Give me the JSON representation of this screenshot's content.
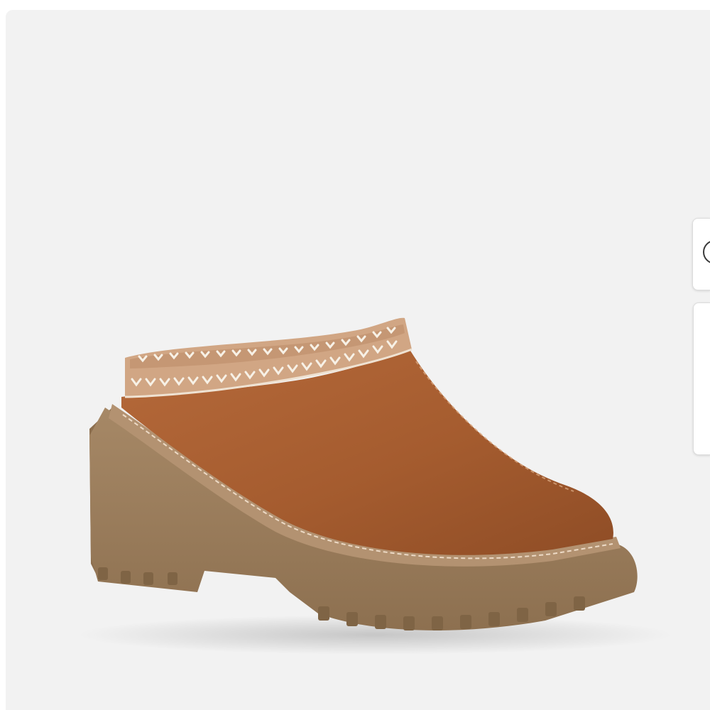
{
  "product": {
    "image_description_icon": "suede-clog-mule-image",
    "colors": {
      "upper": "#a55c2f",
      "sole": "#9b7c5b",
      "trim": "#d1a684",
      "background": "#f2f2f2"
    }
  },
  "side_controls": {
    "top_icon": "circle-icon",
    "bottom_icon": "panel-tab"
  }
}
